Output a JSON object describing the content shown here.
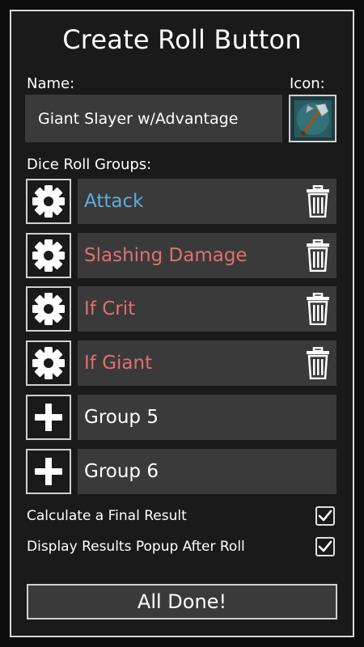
{
  "dialog": {
    "title": "Create Roll Button",
    "name_label": "Name:",
    "name_value": "Giant Slayer w/Advantage",
    "icon_label": "Icon:",
    "icon_name": "axe-icon",
    "groups_label": "Dice Roll Groups:"
  },
  "groups": [
    {
      "label": "Attack",
      "color": "#5aaee0",
      "button_icon": "gear-icon",
      "has_delete": true
    },
    {
      "label": "Slashing Damage",
      "color": "#e07070",
      "button_icon": "gear-icon",
      "has_delete": true
    },
    {
      "label": "If Crit",
      "color": "#e07070",
      "button_icon": "gear-icon",
      "has_delete": true
    },
    {
      "label": "If Giant",
      "color": "#e07070",
      "button_icon": "gear-icon",
      "has_delete": true
    },
    {
      "label": "Group 5",
      "color": "#ffffff",
      "button_icon": "plus-icon",
      "has_delete": false
    },
    {
      "label": "Group 6",
      "color": "#ffffff",
      "button_icon": "plus-icon",
      "has_delete": false
    }
  ],
  "options": [
    {
      "label": "Calculate a Final Result",
      "checked": true
    },
    {
      "label": "Display Results Popup After Roll",
      "checked": true
    }
  ],
  "done_button": "All Done!"
}
